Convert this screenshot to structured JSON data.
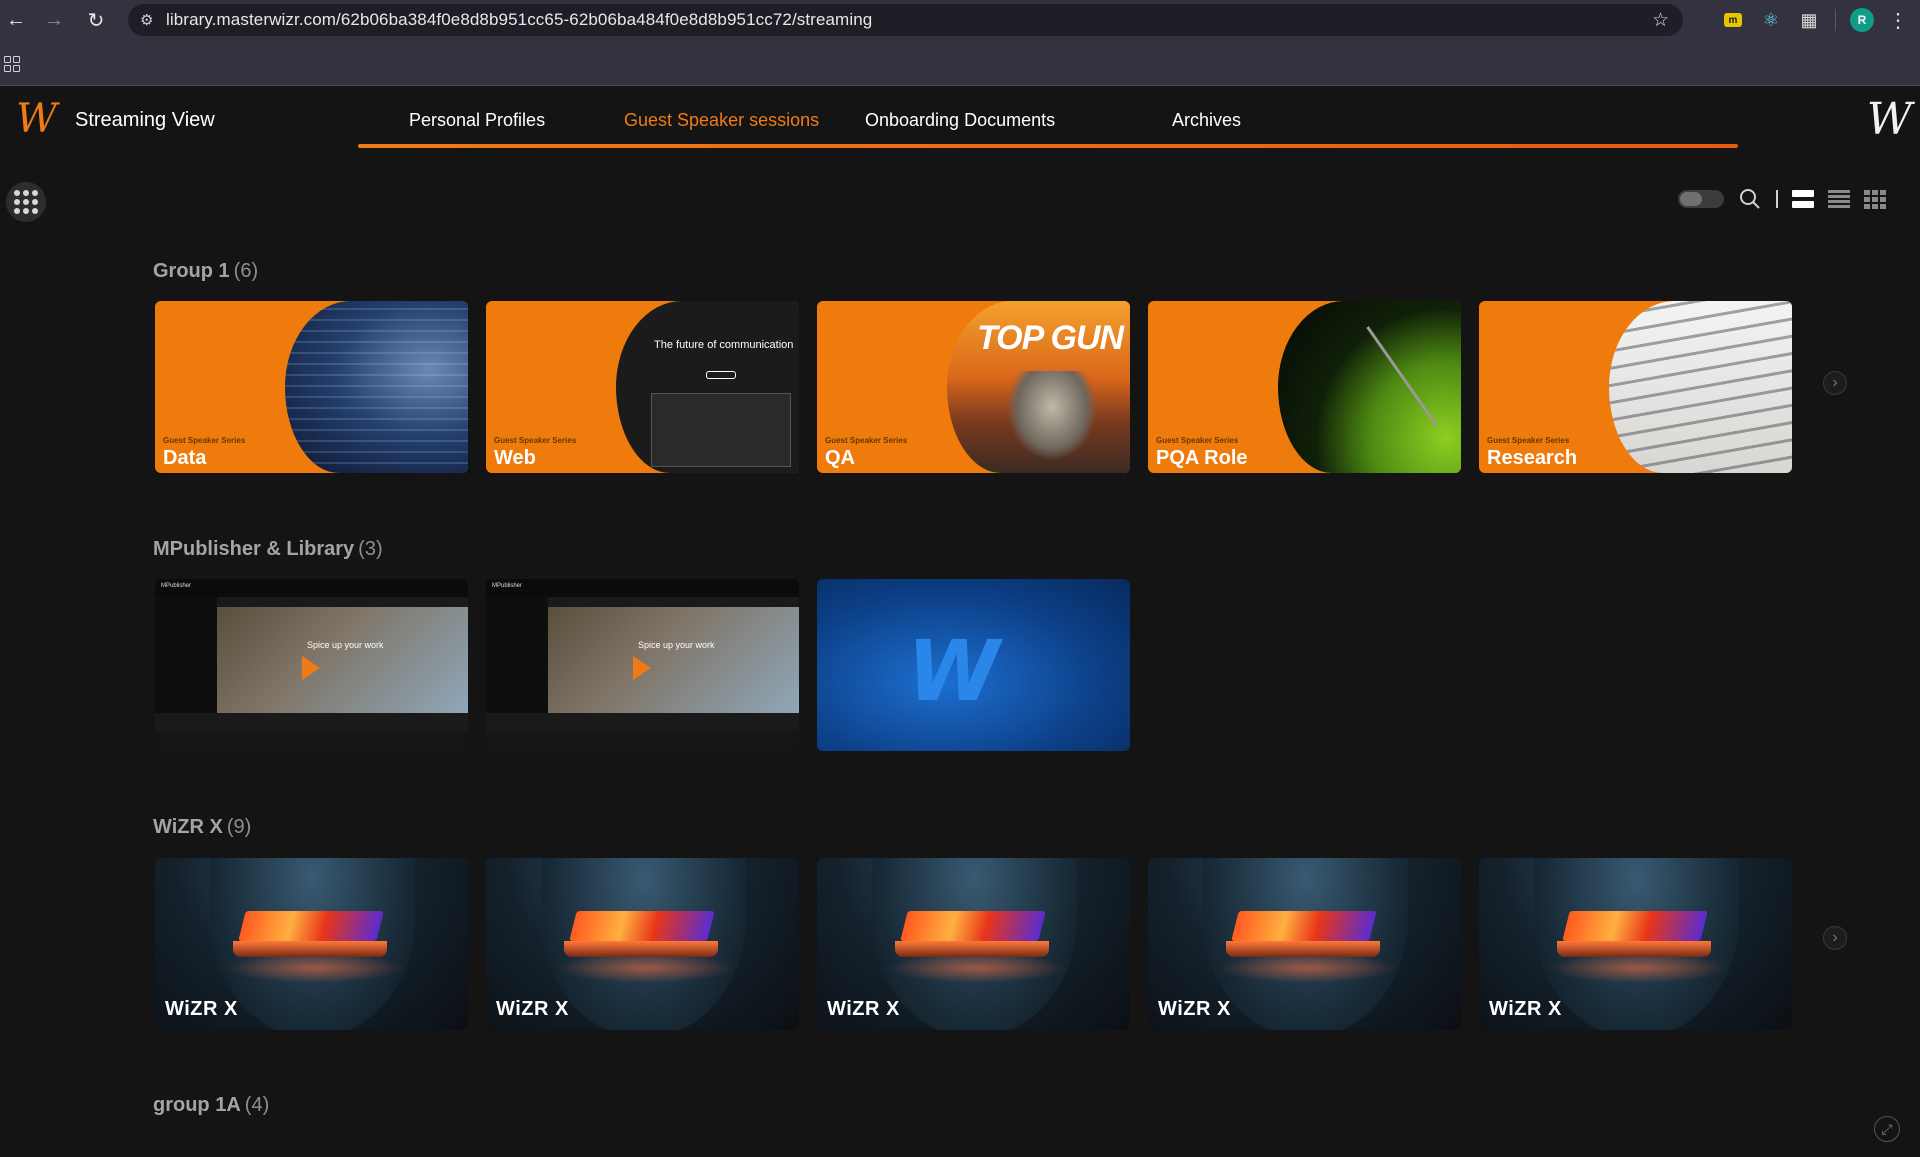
{
  "browser": {
    "url": "library.masterwizr.com/62b06ba384f0e8d8b951cc65-62b06ba484f0e8d8b951cc72/streaming",
    "avatar_letter": "R"
  },
  "app": {
    "title": "Streaming View",
    "accent_color": "#f07b16"
  },
  "tabs": [
    {
      "label": "Personal Profiles",
      "active": false
    },
    {
      "label": "Guest Speaker sessions",
      "active": true
    },
    {
      "label": "Onboarding Documents",
      "active": false
    },
    {
      "label": "Archives",
      "active": false
    }
  ],
  "groups": [
    {
      "title": "Group 1",
      "count": "(6)",
      "cards": [
        {
          "series": "Guest Speaker Series",
          "name": "Data"
        },
        {
          "series": "Guest Speaker Series",
          "name": "Web",
          "headline": "The future of communication"
        },
        {
          "series": "Guest Speaker Series",
          "name": "QA",
          "art_text": "TOP GUN"
        },
        {
          "series": "Guest Speaker Series",
          "name": "PQA Role"
        },
        {
          "series": "Guest Speaker Series",
          "name": "Research"
        }
      ]
    },
    {
      "title": "MPublisher & Library",
      "count": "(3)",
      "cards": [
        {
          "app": "MPublisher",
          "caption": "Spice up your work"
        },
        {
          "app": "MPublisher",
          "caption": "Spice up your work"
        },
        {
          "logo": "W"
        }
      ]
    },
    {
      "title": "WiZR X",
      "count": "(9)",
      "cards": [
        {
          "name": "WiZR X"
        },
        {
          "name": "WiZR X"
        },
        {
          "name": "WiZR X"
        },
        {
          "name": "WiZR X"
        },
        {
          "name": "WiZR X"
        }
      ]
    },
    {
      "title": "group 1A",
      "count": "(4)",
      "cards": []
    }
  ],
  "icons": {
    "back": "arrow-left-icon",
    "forward": "arrow-right-icon",
    "reload": "reload-icon",
    "bookmark": "star-icon",
    "search": "search-icon",
    "menu": "apps-grid-icon",
    "next": "chevron-right-icon",
    "expand": "expand-icon"
  }
}
